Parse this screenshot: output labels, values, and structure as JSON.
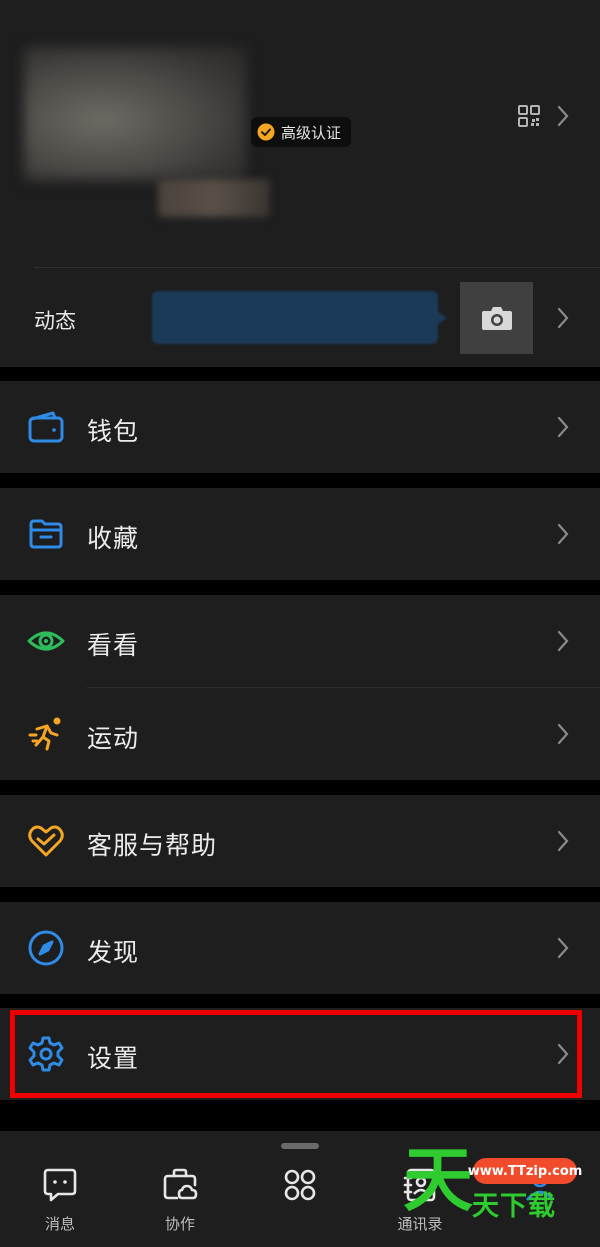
{
  "profile": {
    "badge_label": "高级认证",
    "moments_label": "动态"
  },
  "menu": [
    {
      "label": "钱包",
      "icon": "wallet-icon"
    },
    {
      "label": "收藏",
      "icon": "favorites-folder-icon"
    },
    {
      "label": "看看",
      "icon": "eye-icon"
    },
    {
      "label": "运动",
      "icon": "running-icon"
    },
    {
      "label": "客服与帮助",
      "icon": "heart-help-icon"
    },
    {
      "label": "发现",
      "icon": "compass-icon"
    },
    {
      "label": "设置",
      "icon": "gear-icon"
    }
  ],
  "tabbar": [
    {
      "label": "消息",
      "icon": "chat-icon"
    },
    {
      "label": "协作",
      "icon": "cloud-bag-icon"
    },
    {
      "label": "",
      "icon": "apps-grid-icon"
    },
    {
      "label": "通讯录",
      "icon": "contacts-icon"
    },
    {
      "label": "",
      "icon": "me-icon"
    }
  ],
  "watermark": {
    "char": "天",
    "url": "www.TTzip.com",
    "text": "天下载"
  },
  "colors": {
    "background": "#1e1e1e",
    "blue_accent": "#2f8be6",
    "green_accent": "#2dbd5a",
    "orange_accent": "#f5a623",
    "highlight_red": "#e00000"
  }
}
